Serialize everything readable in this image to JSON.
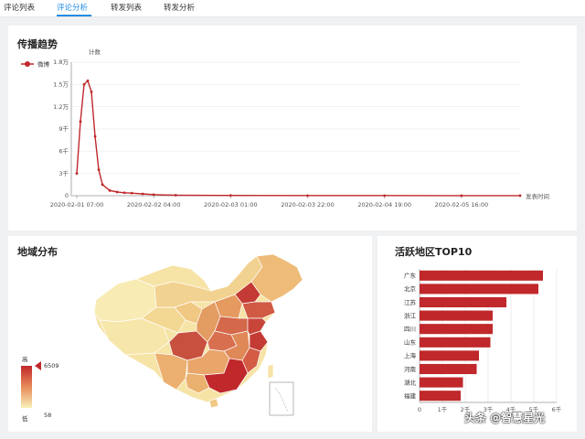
{
  "tabs": [
    "评论列表",
    "评论分析",
    "转发列表",
    "转发分析"
  ],
  "active_tab": 1,
  "trend": {
    "title": "传播趋势",
    "legend": "微博",
    "ylabel": "计数",
    "xlabel": "发表时间",
    "color": "#c0282b"
  },
  "geo": {
    "title": "地域分布",
    "legend_high": "高",
    "legend_low": "低",
    "max_value": "6509",
    "min_value": "58",
    "color_high": "#c0282b",
    "color_low": "#f8f0b8"
  },
  "top10": {
    "title": "活跃地区TOP10"
  },
  "watermark": "头条 @智慧星光",
  "chart_data": [
    {
      "type": "line",
      "series": [
        {
          "name": "微博",
          "x": [
            "2020-02-01 07:00",
            "2020-02-01 08:00",
            "2020-02-01 09:00",
            "2020-02-01 10:00",
            "2020-02-01 11:00",
            "2020-02-01 12:00",
            "2020-02-01 13:00",
            "2020-02-01 14:00",
            "2020-02-01 16:00",
            "2020-02-01 18:00",
            "2020-02-01 20:00",
            "2020-02-01 22:00",
            "2020-02-02 01:00",
            "2020-02-02 04:00",
            "2020-02-02 10:00",
            "2020-02-03 01:00",
            "2020-02-03 22:00",
            "2020-02-04 19:00",
            "2020-02-05 16:00",
            "2020-02-06 08:00"
          ],
          "values": [
            3000,
            10000,
            15000,
            15500,
            14000,
            8000,
            3500,
            1500,
            700,
            500,
            400,
            350,
            250,
            150,
            80,
            40,
            20,
            20,
            10,
            10
          ]
        }
      ],
      "x_ticks": [
        "2020-02-01 07:00",
        "2020-02-02 04:00",
        "2020-02-03 01:00",
        "2020-02-03 22:00",
        "2020-02-04 19:00",
        "2020-02-05 16:00"
      ],
      "y_ticks": [
        "0",
        "3千",
        "6千",
        "9千",
        "1.2万",
        "1.5万",
        "1.8万"
      ],
      "ylim": [
        0,
        18000
      ],
      "ylabel": "计数",
      "xlabel": "发表时间",
      "grid": true,
      "legend": "top-left"
    },
    {
      "type": "bar",
      "orientation": "horizontal",
      "categories": [
        "广东",
        "北京",
        "江苏",
        "浙江",
        "四川",
        "山东",
        "上海",
        "河南",
        "湖北",
        "福建"
      ],
      "values": [
        5400,
        5200,
        3800,
        3200,
        3200,
        3100,
        2600,
        2500,
        1900,
        1800
      ],
      "x_ticks": [
        "0",
        "1千",
        "2千",
        "3千",
        "4千",
        "5千",
        "6千"
      ],
      "xlim": [
        0,
        6000
      ],
      "color": "#c0282b"
    }
  ]
}
